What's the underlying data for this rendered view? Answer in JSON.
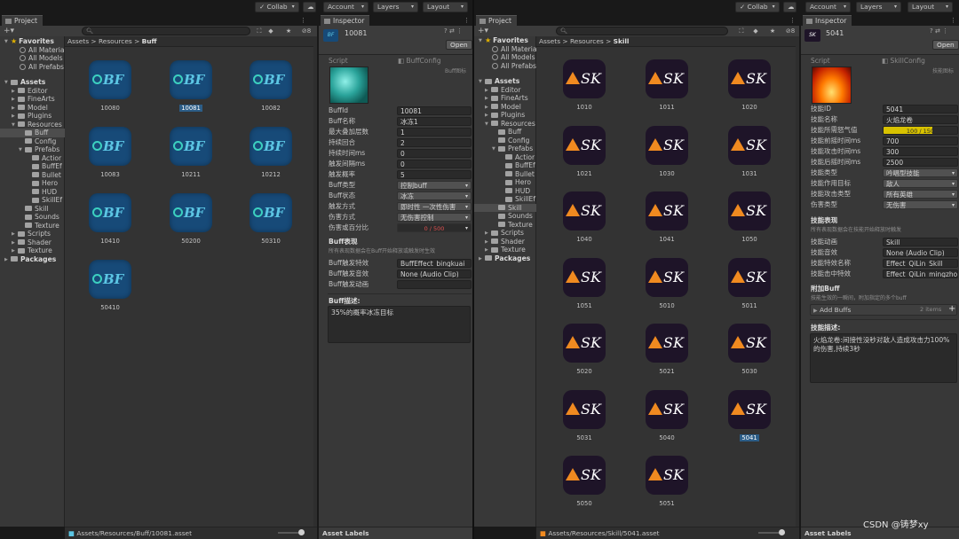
{
  "toolbar": {
    "collab": "Collab",
    "account": "Account",
    "layers": "Layers",
    "layout": "Layout"
  },
  "left": {
    "project_tab": "Project",
    "inspector_tab": "Inspector",
    "favorites": {
      "title": "Favorites",
      "items": [
        "All Materia",
        "All Models",
        "All Prefabs"
      ]
    },
    "assets": "Assets",
    "tree": [
      "Editor",
      "FineArts",
      "Model",
      "Plugins",
      "Resources",
      "Buff",
      "Config",
      "Prefabs",
      "Actior",
      "BuffEf",
      "Bullet",
      "Hero",
      "HUD",
      "SkillEf",
      "Skill",
      "Sounds",
      "Texture",
      "Scripts",
      "Shader",
      "Texture"
    ],
    "packages": "Packages",
    "breadcrumb": [
      "Assets",
      "Resources",
      "Buff"
    ],
    "tiles": [
      "10080",
      "10081",
      "10082",
      "10083",
      "10211",
      "10212",
      "10410",
      "50200",
      "50310",
      "50410"
    ],
    "icon_text": "BF",
    "status_path": "Assets/Resources/Buff/10081.asset",
    "inspector": {
      "title": "10081",
      "open": "Open",
      "script_label": "Script",
      "script_value": "BuffConfig",
      "script_hint": "Buff图标",
      "fields": [
        {
          "label": "BuffId",
          "value": "10081"
        },
        {
          "label": "Buff名称",
          "value": "冰冻1"
        },
        {
          "label": "最大叠加层数",
          "value": "1"
        },
        {
          "label": "持续回合",
          "value": "2"
        },
        {
          "label": "持续时间ms",
          "value": "0"
        },
        {
          "label": "触发间隔ms",
          "value": "0"
        },
        {
          "label": "触发概率",
          "value": "5"
        },
        {
          "label": "Buff类型",
          "value": "控制buff"
        },
        {
          "label": "Buff状态",
          "value": "冰冻"
        },
        {
          "label": "触发方式",
          "value": "即时性 一次性伤害"
        },
        {
          "label": "伤害方式",
          "value": "无伤害控制"
        },
        {
          "label": "伤害或百分比",
          "value": "0 / 500"
        }
      ],
      "damage_fill": 0,
      "section_title": "Buff表现",
      "section_sub": "所有表现数据会在Buff开始释放或触发时生效",
      "effects": [
        {
          "label": "Buff触发特效",
          "value": "BuffEffect_bingkuai"
        },
        {
          "label": "Buff触发音效",
          "value": "None (Audio Clip)"
        },
        {
          "label": "Buff触发动画",
          "value": ""
        }
      ],
      "desc_title": "Buff描述:",
      "desc": "35%的概率冰冻目标"
    },
    "asset_labels": "Asset Labels"
  },
  "right": {
    "project_tab": "Project",
    "inspector_tab": "Inspector",
    "favorites": {
      "title": "Favorites",
      "items": [
        "All Materia",
        "All Models",
        "All Prefabs"
      ]
    },
    "assets": "Assets",
    "tree": [
      "Editor",
      "FineArts",
      "Model",
      "Plugins",
      "Resources",
      "Buff",
      "Config",
      "Prefabs",
      "Actior",
      "BuffEf",
      "Bullet",
      "Hero",
      "HUD",
      "SkillEf",
      "Skill",
      "Sounds",
      "Texture",
      "Scripts",
      "Shader",
      "Texture"
    ],
    "packages": "Packages",
    "breadcrumb": [
      "Assets",
      "Resources",
      "Skill"
    ],
    "tiles": [
      "1010",
      "1011",
      "1020",
      "1021",
      "1030",
      "1031",
      "1040",
      "1041",
      "1050",
      "1051",
      "5010",
      "5011",
      "5020",
      "5021",
      "5030",
      "5031",
      "5040",
      "5041",
      "5050",
      "5051"
    ],
    "icon_text": "SK",
    "status_path": "Assets/Resources/Skill/5041.asset",
    "inspector": {
      "title": "5041",
      "open": "Open",
      "script_label": "Script",
      "script_value": "SkillConfig",
      "script_hint": "技能图标",
      "fields": [
        {
          "label": "技能ID",
          "value": "5041"
        },
        {
          "label": "技能名称",
          "value": "火焰龙卷"
        },
        {
          "label": "技能所需怒气值",
          "value": "100 / 150"
        },
        {
          "label": "技能前摇时间ms",
          "value": "700"
        },
        {
          "label": "技能攻击时间ms",
          "value": "300"
        },
        {
          "label": "技能后摇时间ms",
          "value": "2500"
        },
        {
          "label": "技能类型",
          "value": "吟唱型技能"
        },
        {
          "label": "技能作用目标",
          "value": "敌人"
        },
        {
          "label": "技能攻击类型",
          "value": "所有英雄"
        },
        {
          "label": "伤害类型",
          "value": "无伤害"
        }
      ],
      "rage_fill": 0.667,
      "section_title": "技能表现",
      "section_sub": "所有表现数据会在技能开始释放时触发",
      "effects": [
        {
          "label": "技能动画",
          "value": "Skill"
        },
        {
          "label": "技能音效",
          "value": "None (Audio Clip)"
        },
        {
          "label": "技能特效名称",
          "value": "Effect_QiLin_Skill"
        },
        {
          "label": "技能击中特效",
          "value": "Effect_QiLin_mingzhor"
        }
      ],
      "buff_title": "附加Buff",
      "buff_sub": "技能生效的一瞬间，附加指定的多个buff",
      "add_buffs": "Add Buffs",
      "items_count": "2 items",
      "desc_title": "技能描述:",
      "desc_line1": "火焰龙卷:间接性没秒对敌人造成攻击力100%",
      "desc_line2": "的伤害,持续3秒"
    },
    "asset_labels": "Asset Labels"
  },
  "watermark": "CSDN @铸梦xy"
}
